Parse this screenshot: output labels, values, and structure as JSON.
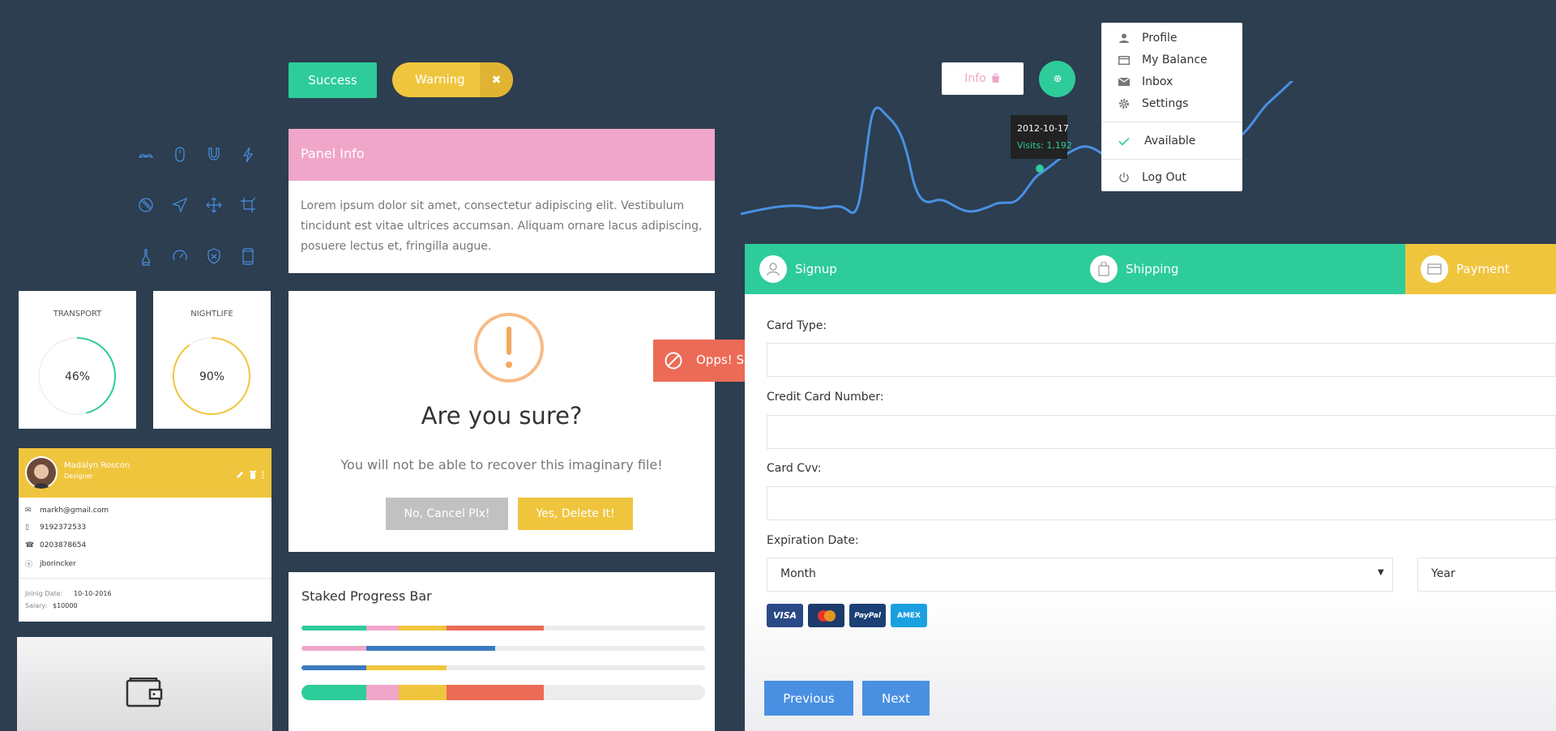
{
  "top_buttons": {
    "success": "Success",
    "warning": "Warning",
    "warning_close": "✖",
    "info": "Info"
  },
  "panel_info": {
    "title": "Panel Info",
    "body": "Lorem ipsum dolor sit amet, consectetur adipiscing elit. Vestibulum tincidunt est vitae ultrices accumsan. Aliquam ornare lacus adipiscing, posuere lectus et, fringilla augue."
  },
  "icon_grid": [
    "mustache-icon",
    "mouse-icon",
    "magnet-icon",
    "lightning-icon",
    "prohibited-icon",
    "navigation-icon",
    "move-icon",
    "crop-icon",
    "pipette-icon",
    "speedometer-icon",
    "shield-icon",
    "tablet-icon"
  ],
  "gauges": [
    {
      "label": "TRANSPORT",
      "value": "46%",
      "fraction": 0.46,
      "color": "#2ecc9a"
    },
    {
      "label": "NIGHTLIFE",
      "value": "90%",
      "fraction": 0.9,
      "color": "#f0c53e"
    }
  ],
  "profile": {
    "name": "Madalyn Roscon",
    "role": "Designer",
    "email": "markh@gmail.com",
    "mobile": "9192372533",
    "phone": "0203878654",
    "skype": "jborincker",
    "joining_label": "Joinig Date:",
    "joining_value": "10-10-2016",
    "salary_label": "Salary:",
    "salary_value": "$10000"
  },
  "confirm": {
    "title": "Are you sure?",
    "message": "You will not be able to recover this imaginary file!",
    "cancel": "No, Cancel Plx!",
    "confirm": "Yes, Delete It!"
  },
  "progress": {
    "title": "Staked Progress Bar",
    "rows": [
      [
        {
          "pct": 16,
          "color": "#2ecc9a"
        },
        {
          "pct": 8,
          "color": "#f0a6c9"
        },
        {
          "pct": 12,
          "color": "#f0c53e"
        },
        {
          "pct": 24,
          "color": "#ec6b56"
        }
      ],
      [
        {
          "pct": 16,
          "color": "#f0a6c9"
        },
        {
          "pct": 32,
          "color": "#3a7bbf"
        }
      ],
      [
        {
          "pct": 16,
          "color": "#3a7bbf"
        },
        {
          "pct": 20,
          "color": "#f0c53e"
        }
      ],
      [
        {
          "pct": 16,
          "color": "#2ecc9a"
        },
        {
          "pct": 8,
          "color": "#f0a6c9"
        },
        {
          "pct": 12,
          "color": "#f0c53e"
        },
        {
          "pct": 24,
          "color": "#ec6b56"
        }
      ]
    ]
  },
  "alert": {
    "message": "Opps! Somthing went wrong.",
    "close": "×"
  },
  "chart": {
    "tooltip_date": "2012-10-17",
    "tooltip_visits": "Visits: 1,192",
    "line_color": "#4a90e2"
  },
  "dropdown": {
    "items": [
      {
        "icon": "user-icon",
        "label": "Profile"
      },
      {
        "icon": "card-icon",
        "label": "My Balance"
      },
      {
        "icon": "envelope-icon",
        "label": "Inbox"
      },
      {
        "icon": "gear-icon",
        "label": "Settings"
      }
    ],
    "available": "Available",
    "logout": "Log Out"
  },
  "wizard": {
    "steps": [
      {
        "icon": "user-icon",
        "label": "Signup"
      },
      {
        "icon": "bag-icon",
        "label": "Shipping"
      },
      {
        "icon": "card-icon",
        "label": "Payment"
      }
    ],
    "card_type_label": "Card Type:",
    "card_number_label": "Credit Card Number:",
    "cvv_label": "Card Cvv:",
    "expiration_label": "Expiration Date:",
    "month_value": "Month",
    "year_value": "Year",
    "cards": [
      "VISA",
      "MasterCard",
      "PayPal",
      "AMEX"
    ],
    "previous": "Previous",
    "next": "Next"
  },
  "colors": {
    "background": "#2c3e50",
    "success": "#2ecc9a",
    "warning": "#f0c53e",
    "pink": "#f0a6c9",
    "danger": "#ec6b56",
    "primary": "#4a90e2"
  }
}
